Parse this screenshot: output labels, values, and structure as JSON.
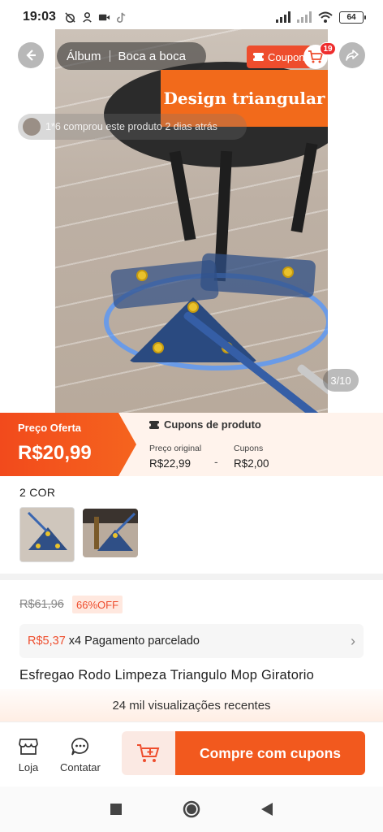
{
  "status_bar": {
    "time": "19:03",
    "battery": "64"
  },
  "gallery": {
    "album_label": "Álbum",
    "boca_label": "Boca a boca",
    "coupon_label": "Coupon",
    "cart_count": "19",
    "banner_text": "Design triangular",
    "buyer_toast": "1*6 comprou este produto 2 dias atrás",
    "page_counter": "3/10"
  },
  "price_band": {
    "offer_label": "Preço Oferta",
    "offer_price": "R$20,99",
    "coupons_title": "Cupons de produto",
    "original_label": "Preço original",
    "original_value": "R$22,99",
    "dash": "-",
    "coupon_label": "Cupons",
    "coupon_value": "R$2,00"
  },
  "variants": {
    "title": "2 COR"
  },
  "details": {
    "old_price": "R$61,96",
    "discount": "66%OFF",
    "installment_price": "R$5,37",
    "installment_text": "x4 Pagamento parcelado",
    "product_title": "Esfregao Rodo Limpeza Triangulo Mop Giratorio",
    "views_text": "24 mil visualizações recentes"
  },
  "actions": {
    "shop_label": "Loja",
    "contact_label": "Contatar",
    "buy_label": "Compre com cupons"
  },
  "colors": {
    "accent": "#ee4d2d",
    "buy_button": "#f2591e",
    "banner": "#f26a1b"
  },
  "icons": {
    "back": "back-arrow-icon",
    "share": "share-icon",
    "cart": "shopping-cart-icon",
    "shop": "store-icon",
    "contact": "chat-bubble-icon",
    "add_to_cart": "cart-plus-icon"
  }
}
